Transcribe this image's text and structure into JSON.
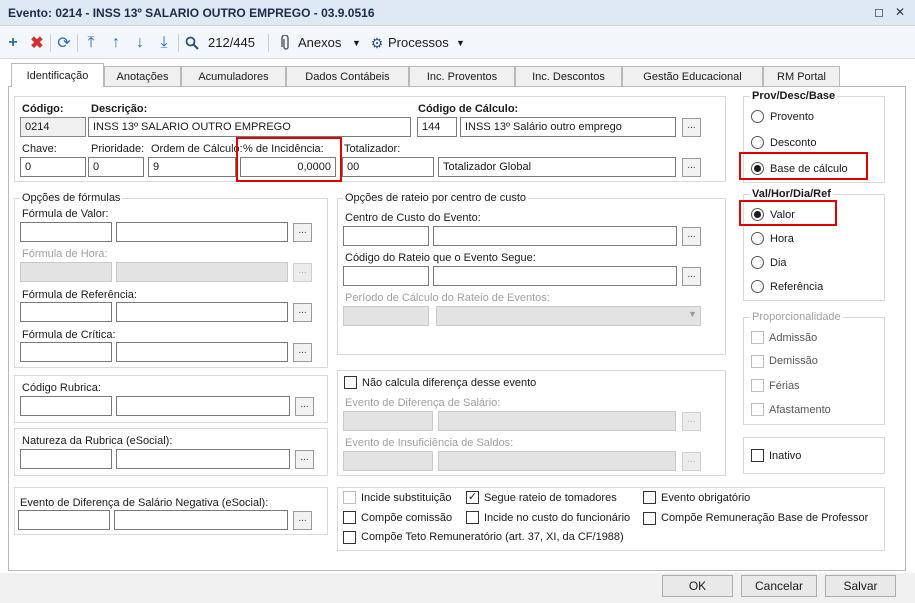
{
  "window": {
    "title": "Evento: 0214 - INSS 13º SALARIO OUTRO EMPREGO - 03.9.0516",
    "restore_glyph": "◻",
    "close_glyph": "✕"
  },
  "toolbar": {
    "record_counter": "212/445",
    "anexos_label": "Anexos",
    "processos_label": "Processos",
    "icons": [
      "add-icon",
      "delete-icon",
      "refresh-icon",
      "first-icon",
      "previous-icon",
      "next-icon",
      "last-icon",
      "search-icon",
      "paperclip-icon",
      "gear-icon"
    ]
  },
  "tabs": [
    {
      "label": "Identificação"
    },
    {
      "label": "Anotações"
    },
    {
      "label": "Acumuladores"
    },
    {
      "label": "Dados Contábeis"
    },
    {
      "label": "Inc. Proventos"
    },
    {
      "label": "Inc. Descontos"
    },
    {
      "label": "Gestão Educacional"
    },
    {
      "label": "RM Portal"
    }
  ],
  "form": {
    "codigo_label": "Código:",
    "codigo_value": "0214",
    "descricao_label": "Descrição:",
    "descricao_value": "INSS 13º SALARIO OUTRO EMPREGO",
    "codigo_calculo_label": "Código de Cálculo:",
    "codigo_calculo_code": "144",
    "codigo_calculo_desc": "INSS 13º Salário outro emprego",
    "chave_label": "Chave:",
    "chave_value": "0",
    "prioridade_label": "Prioridade:",
    "prioridade_value": "0",
    "ordem_label": "Ordem de Cálculo:",
    "ordem_value": "9",
    "incidencia_label": "% de Incidência:",
    "incidencia_value": "0,0000",
    "totalizador_label": "Totalizador:",
    "totalizador_code": "00",
    "totalizador_desc": "Totalizador Global",
    "ellipsis": "..."
  },
  "formulas": {
    "title": "Opções de fórmulas",
    "valor_label": "Fórmula de Valor:",
    "hora_label": "Fórmula de Hora:",
    "referencia_label": "Fórmula de Referência:",
    "critica_label": "Fórmula de Crítica:"
  },
  "rateio": {
    "title": "Opções de rateio por centro de custo",
    "centro_label": "Centro de Custo do Evento:",
    "codigo_label": "Código do Rateio que o Evento Segue:",
    "periodo_label": "Período de Cálculo do Rateio de Eventos:"
  },
  "rubrica": {
    "codigo_label": "Código Rubrica:",
    "natureza_label": "Natureza da Rubrica (eSocial):",
    "evento_negativa_label": "Evento de Diferença de Salário Negativa (eSocial):"
  },
  "diferenca": {
    "nao_calcula_label": "Não calcula diferença desse evento",
    "evento_diferenca_label": "Evento de Diferença de Salário:",
    "evento_insuficiencia_label": "Evento de Insuficiência de Saldos:"
  },
  "checks": {
    "incide_substituicao": "Incide substituição",
    "segue_rateio": "Segue rateio de tomadores",
    "evento_obrigatorio": "Evento obrigatório",
    "compoe_comissao": "Compõe comissão",
    "incide_custo": "Incide no custo do funcionário",
    "compoe_remuneracao": "Compõe Remuneração Base de Professor",
    "compoe_teto": "Compõe Teto Remuneratório (art. 37, XI, da CF/1988)",
    "check_mark": "✓"
  },
  "prov_desc": {
    "title": "Prov/Desc/Base",
    "provento": "Provento",
    "desconto": "Desconto",
    "base": "Base de cálculo"
  },
  "val_hor": {
    "title": "Val/Hor/Dia/Ref",
    "valor": "Valor",
    "hora": "Hora",
    "dia": "Dia",
    "referencia": "Referência"
  },
  "proporcionalidade": {
    "title": "Proporcionalidade",
    "admissao": "Admissão",
    "demissao": "Demissão",
    "ferias": "Férias",
    "afastamento": "Afastamento"
  },
  "inativo_label": "Inativo",
  "footer": {
    "ok": "OK",
    "cancelar": "Cancelar",
    "salvar": "Salvar"
  },
  "colors": {
    "highlight": "#e00000",
    "toolbar_icon": "#2b6cb0",
    "delete_icon": "#d32f2f"
  }
}
